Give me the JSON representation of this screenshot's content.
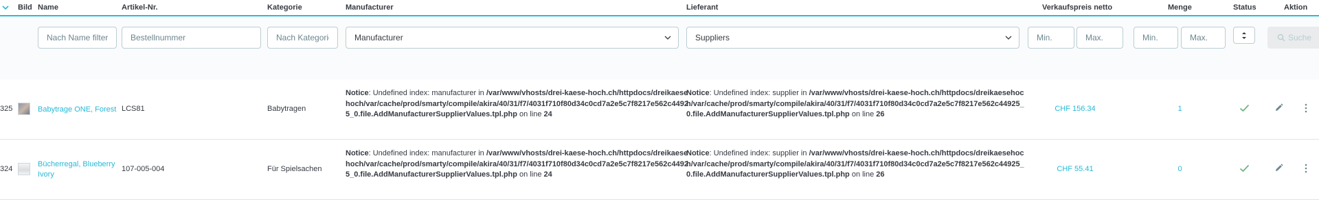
{
  "header": {
    "bild": "Bild",
    "name": "Name",
    "artikel": "Artikel-Nr.",
    "kategorie": "Kategorie",
    "manufacturer": "Manufacturer",
    "lieferant": "Lieferant",
    "preis": "Verkaufspreis netto",
    "menge": "Menge",
    "status": "Status",
    "aktion": "Aktion"
  },
  "filters": {
    "name_placeholder": "Nach Name filtern",
    "bestell_placeholder": "Bestellnummer",
    "kategorie_placeholder": "Nach Kategorie",
    "manufacturer_value": "Manufacturer",
    "supplier_value": "Suppliers",
    "preis_min": "Min.",
    "preis_max": "Max.",
    "menge_min": "Min.",
    "menge_max": "Max.",
    "search_label": "Suche"
  },
  "rows": [
    {
      "id": "325",
      "name": "Babytrage ONE, Forest",
      "sku": "LCS81",
      "category": "Babytragen",
      "m_notice_label": "Notice",
      "m_notice_text": ": Undefined index: manufacturer in ",
      "m_path": "/var/www/vhosts/drei-kaese-hoch.ch/httpdocs/dreikaesehoch/var/cache/prod/smarty/compile/akira/40/31/f7/4031f710f80d34c0cd7a2e5c7f8217e562c44925_0.file.AddManufacturerSupplierValues.tpl.php",
      "m_online": " on line ",
      "m_line": "24",
      "s_notice_label": "Notice",
      "s_notice_text": ": Undefined index: supplier in ",
      "s_path": "/var/www/vhosts/drei-kaese-hoch.ch/httpdocs/dreikaesehoch/var/cache/prod/smarty/compile/akira/40/31/f7/4031f710f80d34c0cd7a2e5c7f8217e562c44925_0.file.AddManufacturerSupplierValues.tpl.php",
      "s_online": " on line ",
      "s_line": "26",
      "price": "CHF 156.34",
      "qty": "1"
    },
    {
      "id": "324",
      "name": "Bücherregal, Blueberry Ivory",
      "sku": "107-005-004",
      "category": "Für Spielsachen",
      "m_notice_label": "Notice",
      "m_notice_text": ": Undefined index: manufacturer in ",
      "m_path": "/var/www/vhosts/drei-kaese-hoch.ch/httpdocs/dreikaesehoch/var/cache/prod/smarty/compile/akira/40/31/f7/4031f710f80d34c0cd7a2e5c7f8217e562c44925_0.file.AddManufacturerSupplierValues.tpl.php",
      "m_online": " on line ",
      "m_line": "24",
      "s_notice_label": "Notice",
      "s_notice_text": ": Undefined index: supplier in ",
      "s_path": "/var/www/vhosts/drei-kaese-hoch.ch/httpdocs/dreikaesehoch/var/cache/prod/smarty/compile/akira/40/31/f7/4031f710f80d34c0cd7a2e5c7f8217e562c44925_0.file.AddManufacturerSupplierValues.tpl.php",
      "s_online": " on line ",
      "s_line": "26",
      "price": "CHF 55.41",
      "qty": "0"
    }
  ],
  "colors": {
    "accent": "#25b9d7",
    "check": "#70b580",
    "text": "#363a41"
  },
  "icons": [
    "sort-caret-icon",
    "chevron-down-icon",
    "search-icon",
    "check-icon",
    "edit-pencil-icon",
    "more-vertical-icon"
  ]
}
